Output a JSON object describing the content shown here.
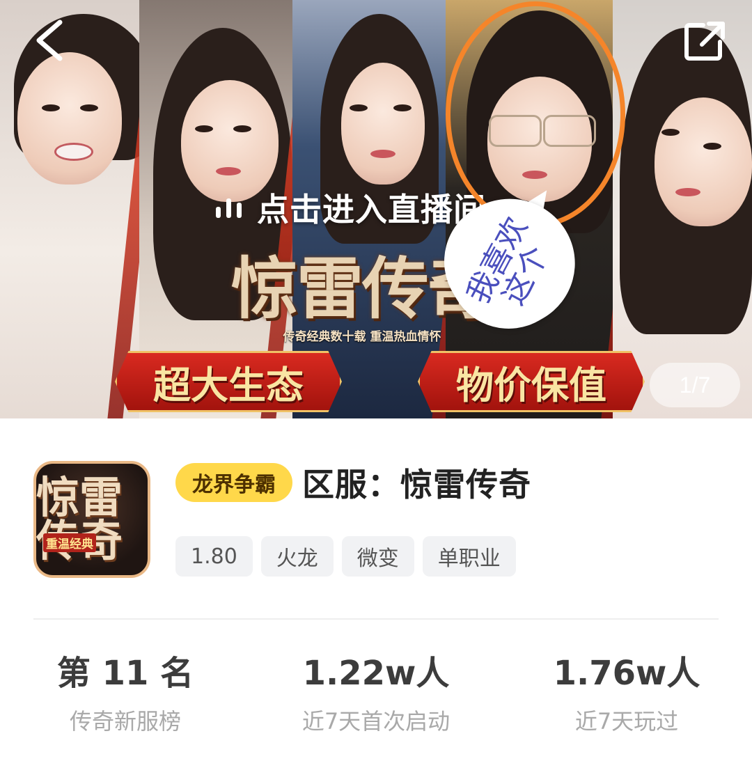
{
  "banner": {
    "live_text": "点击进入直播间",
    "logo_title": "惊雷传奇",
    "logo_slogan": "传奇经典数十载 重温热血情怀",
    "ribbon_left": "超大生态",
    "ribbon_right": "物价保值",
    "page_indicator": "1/7",
    "bubble_text": "我喜欢这个",
    "ring_color": "#f5852a",
    "bubble_text_color": "#4a4fbd"
  },
  "game": {
    "icon_title": "惊雷传奇",
    "icon_tag": "重温经典",
    "server_badge": "龙界争霸",
    "title": "区服：惊雷传奇",
    "tags": [
      "1.80",
      "火龙",
      "微变",
      "单职业"
    ]
  },
  "stats": [
    {
      "value": "第 11 名",
      "label": "传奇新服榜"
    },
    {
      "value": "1.22w人",
      "label": "近7天首次启动"
    },
    {
      "value": "1.76w人",
      "label": "近7天玩过"
    }
  ],
  "icons": {
    "back": "chevron-left-icon",
    "share": "external-link-icon",
    "live": "live-bars-icon"
  },
  "colors": {
    "badge_bg": "#ffd84a",
    "ribbon_red": "#d92a20",
    "text_dark": "#222222",
    "text_muted": "#a9a9a9"
  }
}
